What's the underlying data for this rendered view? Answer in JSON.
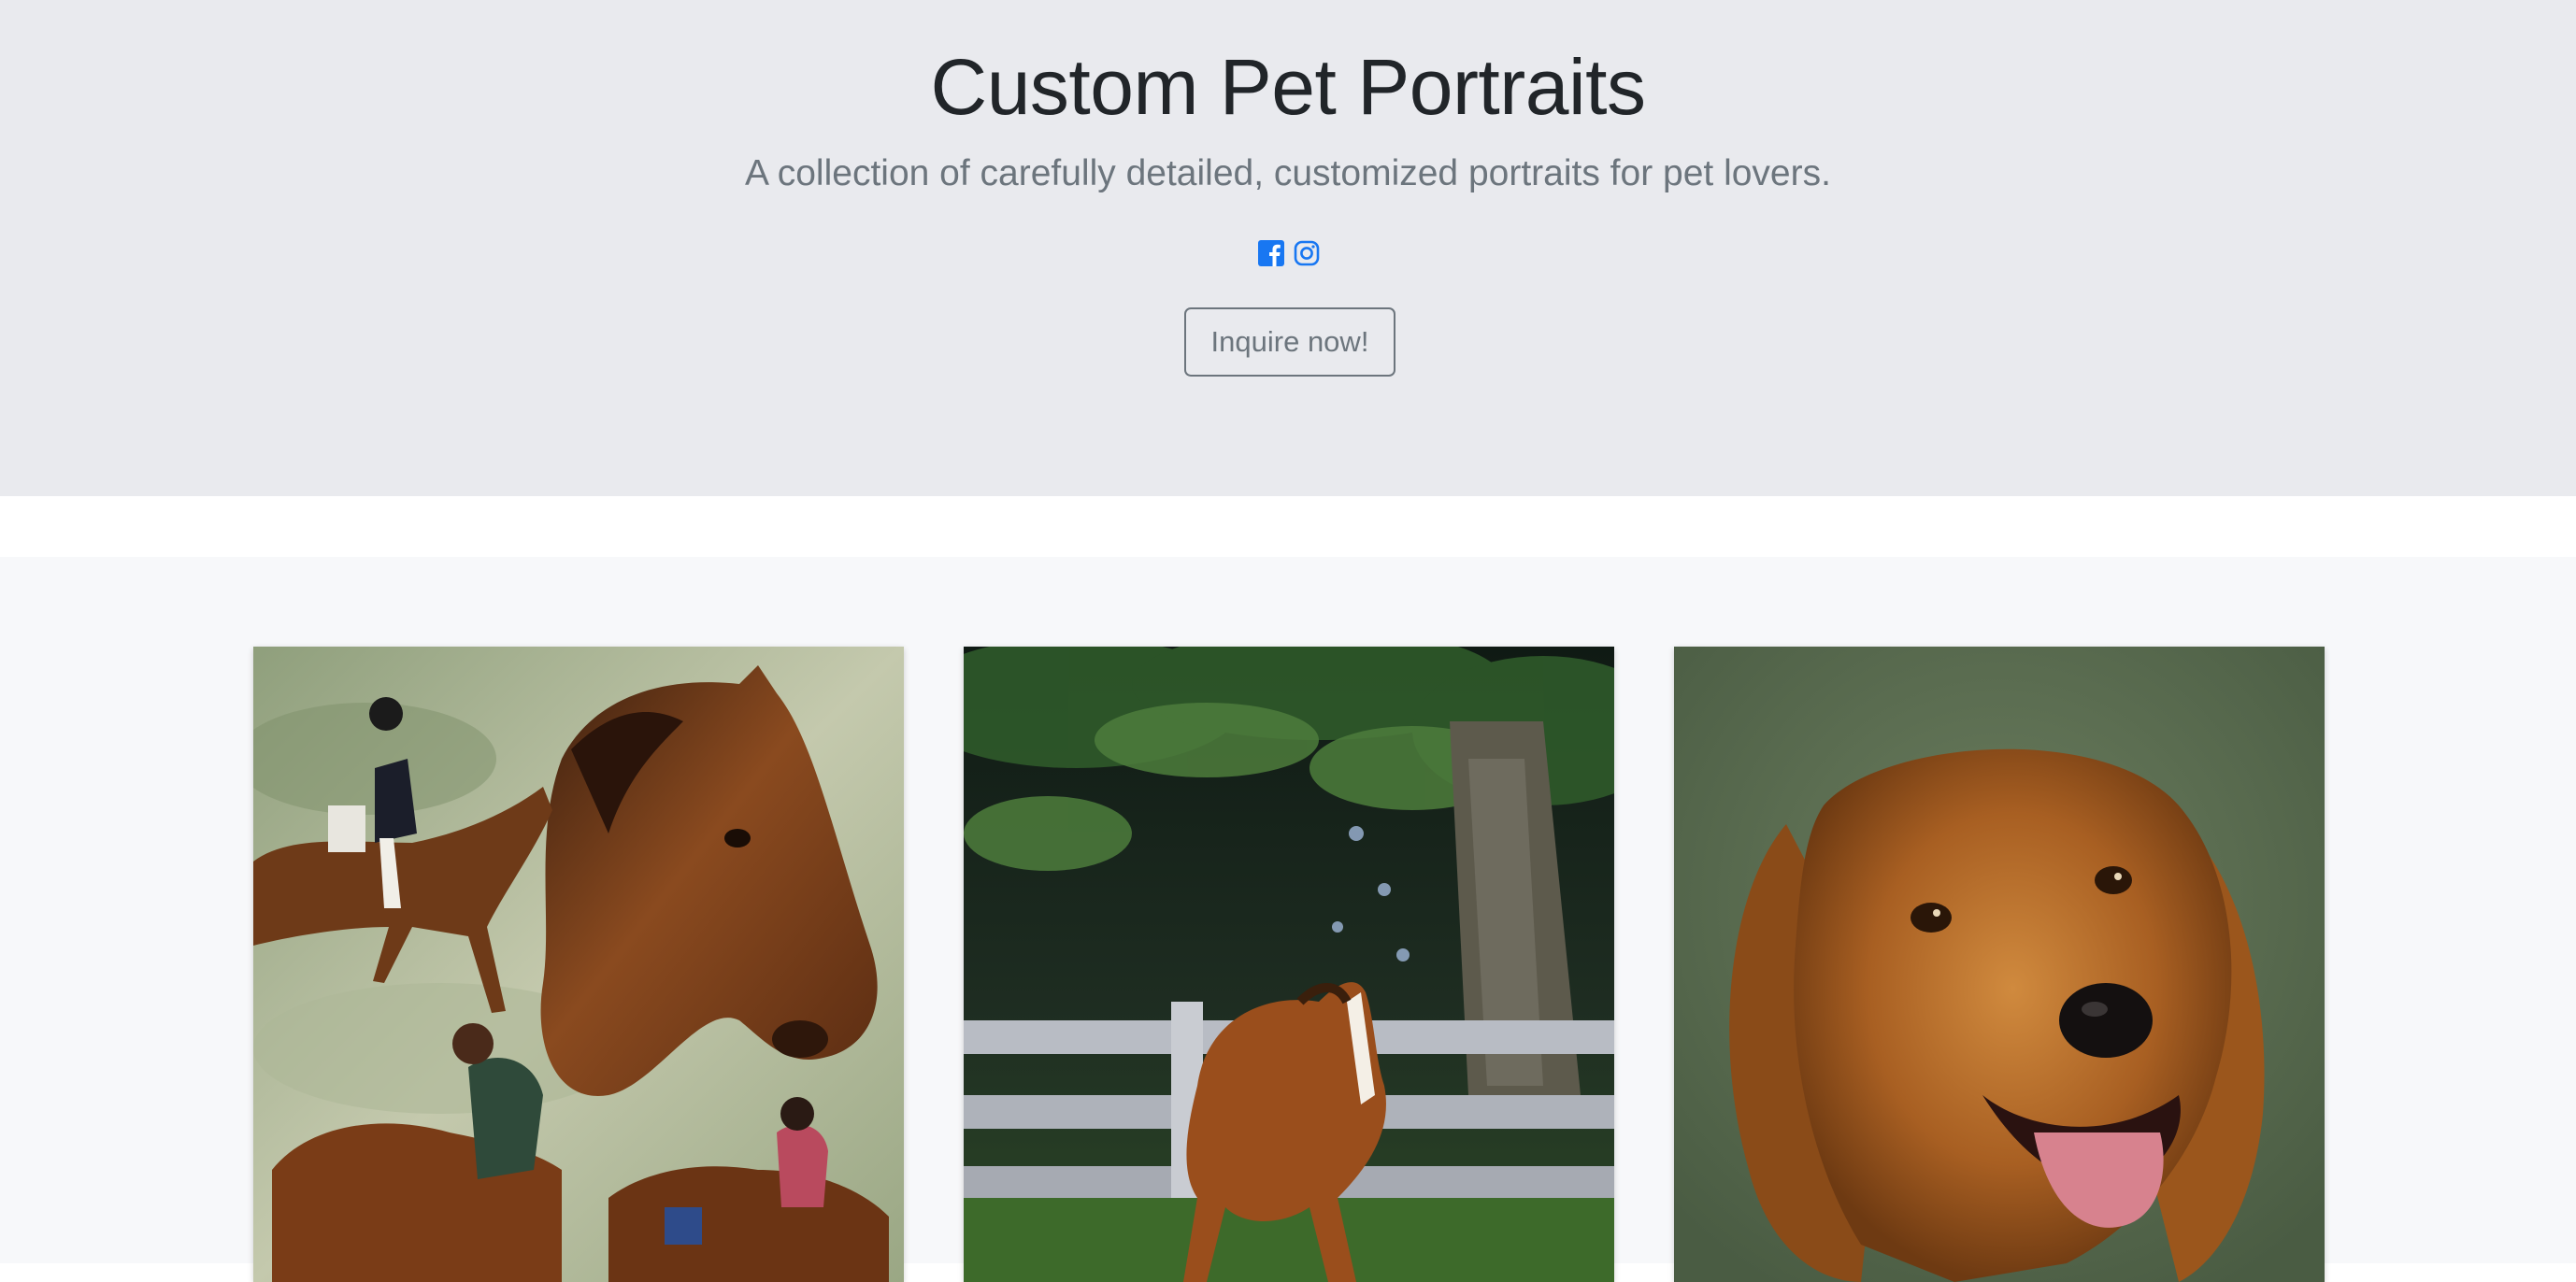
{
  "hero": {
    "title": "Custom Pet Portraits",
    "subtitle": "A collection of carefully detailed, customized portraits for pet lovers.",
    "social_icons": [
      "facebook-icon",
      "instagram-icon"
    ],
    "button_label": "Inquire now!",
    "accent_color": "#1877f2"
  },
  "gallery": {
    "items": [
      {
        "subject": "horse-collage-painting"
      },
      {
        "subject": "running-horse-fence-painting"
      },
      {
        "subject": "golden-retriever-painting"
      }
    ]
  }
}
